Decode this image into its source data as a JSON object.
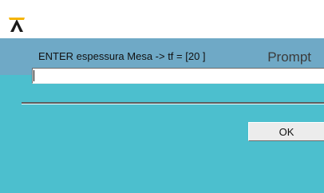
{
  "app": {
    "logo_icon": "ansys-logo-icon",
    "logo_color": "#f5b400"
  },
  "dialog": {
    "title": "Prompt",
    "titlebar_color": "#6fa9c6",
    "body_color": "#4cbfce",
    "prompt_text": "ENTER espessura Mesa -> tf = [20 ]",
    "input_value": "",
    "ok_label": "OK"
  }
}
